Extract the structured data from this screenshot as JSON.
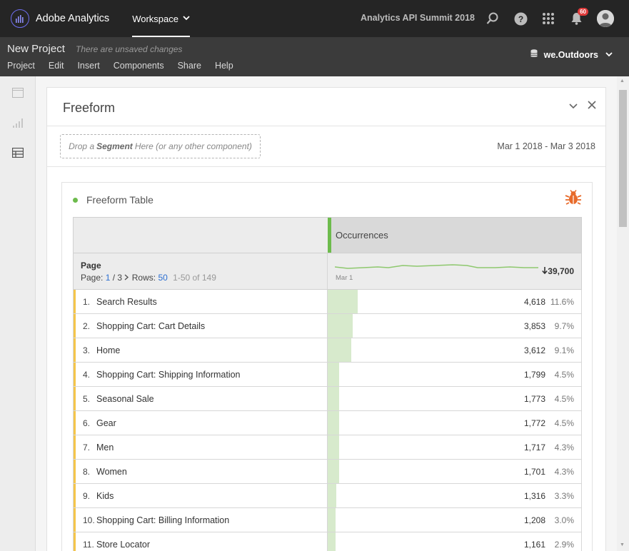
{
  "topnav": {
    "app_name": "Adobe Analytics",
    "workspace_label": "Workspace",
    "company": "Analytics API Summit 2018",
    "notification_count": "60"
  },
  "project": {
    "title": "New Project",
    "unsaved": "There are unsaved changes",
    "menu": [
      "Project",
      "Edit",
      "Insert",
      "Components",
      "Share",
      "Help"
    ],
    "report_suite": "we.Outdoors"
  },
  "panel": {
    "title": "Freeform",
    "dropzone_pre": "Drop a",
    "dropzone_bold": "Segment",
    "dropzone_post": "Here (or any other component)",
    "date_range": "Mar 1 2018 - Mar 3 2018"
  },
  "viz": {
    "title": "Freeform Table",
    "metric_name": "Occurrences",
    "dimension_name": "Page",
    "page_label": "Page:",
    "page_current": "1",
    "page_total": "/ 3",
    "rows_label": "Rows:",
    "rows_value": "50",
    "rows_range": "1-50 of 149",
    "spark_date": "Mar 1",
    "total": "39,700",
    "accent_color": "#6dbb4c",
    "bar_color": "#d7eacc",
    "rows": [
      {
        "num": "1.",
        "label": "Search Results",
        "value": "4,618",
        "pct": "11.6%",
        "share": 0.116
      },
      {
        "num": "2.",
        "label": "Shopping Cart: Cart Details",
        "value": "3,853",
        "pct": "9.7%",
        "share": 0.097
      },
      {
        "num": "3.",
        "label": "Home",
        "value": "3,612",
        "pct": "9.1%",
        "share": 0.091
      },
      {
        "num": "4.",
        "label": "Shopping Cart: Shipping Information",
        "value": "1,799",
        "pct": "4.5%",
        "share": 0.045
      },
      {
        "num": "5.",
        "label": "Seasonal Sale",
        "value": "1,773",
        "pct": "4.5%",
        "share": 0.045
      },
      {
        "num": "6.",
        "label": "Gear",
        "value": "1,772",
        "pct": "4.5%",
        "share": 0.045
      },
      {
        "num": "7.",
        "label": "Men",
        "value": "1,717",
        "pct": "4.3%",
        "share": 0.043
      },
      {
        "num": "8.",
        "label": "Women",
        "value": "1,701",
        "pct": "4.3%",
        "share": 0.043
      },
      {
        "num": "9.",
        "label": "Kids",
        "value": "1,316",
        "pct": "3.3%",
        "share": 0.033
      },
      {
        "num": "10.",
        "label": "Shopping Cart: Billing Information",
        "value": "1,208",
        "pct": "3.0%",
        "share": 0.03
      },
      {
        "num": "11.",
        "label": "Store Locator",
        "value": "1,161",
        "pct": "2.9%",
        "share": 0.029
      }
    ]
  }
}
